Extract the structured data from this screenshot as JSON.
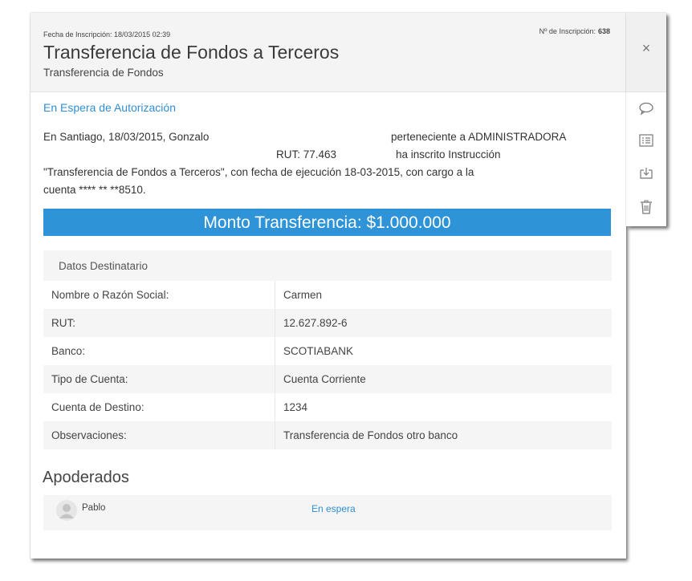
{
  "header": {
    "registration_date": "Fecha de Inscripción: 18/03/2015 02:39",
    "registration_number_label": "Nº de Inscripción:",
    "registration_number": "638",
    "title": "Transferencia de Fondos a Terceros",
    "subtitle": "Transferencia de Fondos"
  },
  "status": "En Espera de Autorización",
  "description": {
    "line1a": "En Santiago, 18/03/2015, Gonzalo",
    "line1b": "perteneciente a ADMINISTRADORA",
    "line2a": "RUT: 77.463",
    "line2b": "ha inscrito Instrucción",
    "line3": "\"Transferencia de Fondos a Terceros\", con fecha de ejecución 18-03-2015, con cargo a la",
    "line4": "cuenta **** ** **8510."
  },
  "amount_banner": "Monto Transferencia: $1.000.000",
  "recipient": {
    "section_title": "Datos Destinatario",
    "rows": [
      {
        "label": "Nombre o Razón Social:",
        "value": "Carmen"
      },
      {
        "label": "RUT:",
        "value": "12.627.892-6"
      },
      {
        "label": "Banco:",
        "value": "SCOTIABANK"
      },
      {
        "label": "Tipo de Cuenta:",
        "value": "Cuenta Corriente"
      },
      {
        "label": "Cuenta de Destino:",
        "value": "1234"
      },
      {
        "label": "Observaciones:",
        "value": "Transferencia de Fondos otro banco"
      }
    ]
  },
  "apoderados": {
    "title": "Apoderados",
    "items": [
      {
        "name": "Pablo",
        "status": "En espera"
      }
    ]
  },
  "side_actions": {
    "close": "×",
    "icons": [
      "comment-icon",
      "list-icon",
      "download-icon",
      "trash-icon"
    ]
  },
  "colors": {
    "accent": "#2f93d8",
    "link": "#2f8fd1",
    "row_alt": "#f5f5f5"
  }
}
